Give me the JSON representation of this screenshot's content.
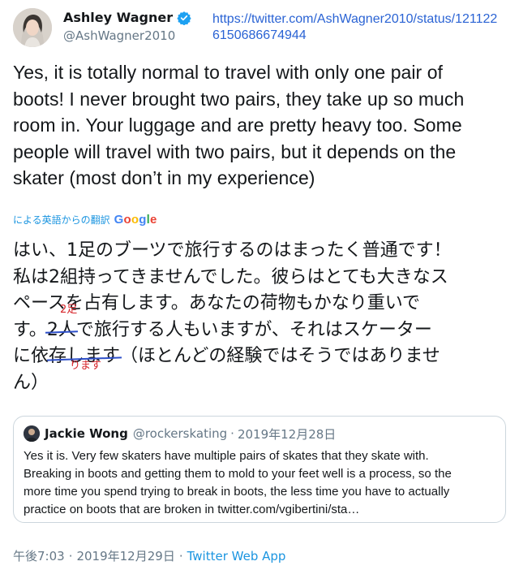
{
  "author": {
    "display_name": "Ashley Wagner",
    "handle": "@AshWagner2010",
    "avatar_icon": "profile-photo",
    "verified_icon": "verified-badge-icon"
  },
  "source_url": "https://twitter.com/AshWagner2010/status/1211226150686674944",
  "tweet": {
    "lines": [
      "Yes, it is totally normal to travel with only one pair of",
      "boots! I never brought two pairs, they take up so much",
      "room in. Your luggage and are pretty heavy too. Some",
      "people will travel with two pairs, but it depends on the",
      "skater (most don’t in my experience)"
    ]
  },
  "translation": {
    "label": "による英語からの翻訳",
    "provider": "Google",
    "line1": "はい、1足のブーツで旅行するのはまったく普通です！",
    "line2": "私は2組持ってきませんでした。彼らはとても大きなス",
    "line3": "ペースを占有します。あなたの荷物もかなり重いでs",
    "line4_a": "す。",
    "line4_struck": "2人",
    "line4_b": "で旅行する人もいますが、それはスケーター",
    "line5_a": "に依",
    "line5_struck": "存します",
    "line5_b": "（ほとんどの経験ではそうではありませ",
    "line6": "ん）",
    "correction_1": "2足",
    "correction_2": "ります"
  },
  "quoted_tweet": {
    "name": "Jackie Wong",
    "handle": "@rockerskating",
    "separator": "·",
    "date": "2019年12月28日",
    "lines": [
      "Yes it is. Very few skaters have multiple pairs of skates that they skate with.",
      "Breaking in boots and getting them to mold to your feet well is a process, so the",
      "more time you spend trying to break in boots, the less time you have to actually",
      "practice on boots that are broken in twitter.com/vgibertini/sta…"
    ]
  },
  "footer": {
    "time": "午後7:03",
    "sep1": "·",
    "date": "2019年12月29日",
    "sep2": "·",
    "app": "Twitter Web App"
  },
  "colors": {
    "link_blue": "#1b95e0",
    "annotation_red": "#d7262b",
    "strike_blue": "#2d4fc9"
  }
}
